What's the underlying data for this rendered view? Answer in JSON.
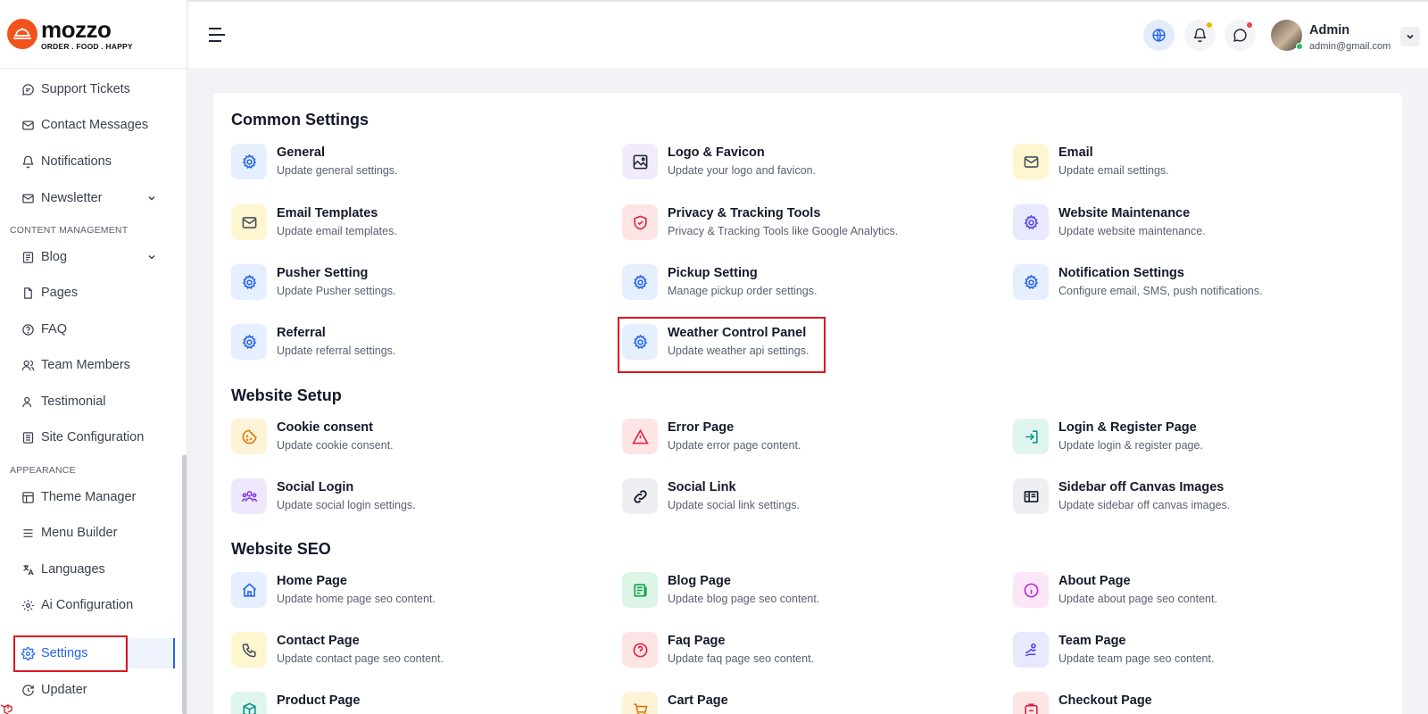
{
  "brand": {
    "name": "mozzo",
    "tagline": "ORDER . FOOD . HAPPY"
  },
  "sidebar": {
    "items": [
      {
        "label": "Support Tickets",
        "icon": "chat-icon"
      },
      {
        "label": "Contact Messages",
        "icon": "mail-icon"
      },
      {
        "label": "Notifications",
        "icon": "bell-icon"
      },
      {
        "label": "Newsletter",
        "icon": "newsletter-icon"
      },
      {
        "label": "Blog",
        "icon": "blog-icon"
      },
      {
        "label": "Pages",
        "icon": "page-icon"
      },
      {
        "label": "FAQ",
        "icon": "help-icon"
      },
      {
        "label": "Team Members",
        "icon": "users-icon"
      },
      {
        "label": "Testimonial",
        "icon": "user-icon"
      },
      {
        "label": "Site Configuration",
        "icon": "config-icon"
      },
      {
        "label": "Theme Manager",
        "icon": "theme-icon"
      },
      {
        "label": "Menu Builder",
        "icon": "menu-icon"
      },
      {
        "label": "Languages",
        "icon": "language-icon"
      },
      {
        "label": "Ai Configuration",
        "icon": "ai-icon"
      },
      {
        "label": "Settings",
        "icon": "gear-icon"
      },
      {
        "label": "Updater",
        "icon": "update-icon"
      }
    ],
    "sections": [
      "CONTENT MANAGEMENT",
      "APPEARANCE"
    ],
    "active": "Settings"
  },
  "header": {
    "user_name": "Admin",
    "user_email": "admin@gmail.com"
  },
  "sections": [
    {
      "title": "Common Settings",
      "items": [
        {
          "title": "General",
          "desc": "Update general settings.",
          "icon": "gear-icon"
        },
        {
          "title": "Logo & Favicon",
          "desc": "Update your logo and favicon.",
          "icon": "image-icon"
        },
        {
          "title": "Email",
          "desc": "Update email settings.",
          "icon": "mail-icon"
        },
        {
          "title": "Email Templates",
          "desc": "Update email templates.",
          "icon": "mail-icon"
        },
        {
          "title": "Privacy & Tracking Tools",
          "desc": "Privacy & Tracking Tools like Google Analytics.",
          "icon": "shield-icon"
        },
        {
          "title": "Website Maintenance",
          "desc": "Update website maintenance.",
          "icon": "gear-icon"
        },
        {
          "title": "Pusher Setting",
          "desc": "Update Pusher settings.",
          "icon": "gear-icon"
        },
        {
          "title": "Pickup Setting",
          "desc": "Manage pickup order settings.",
          "icon": "gear-icon"
        },
        {
          "title": "Notification Settings",
          "desc": "Configure email, SMS, push notifications.",
          "icon": "gear-icon"
        },
        {
          "title": "Referral",
          "desc": "Update referral settings.",
          "icon": "gear-icon"
        },
        {
          "title": "Weather Control Panel",
          "desc": "Update weather api settings.",
          "icon": "gear-icon"
        }
      ]
    },
    {
      "title": "Website Setup",
      "items": [
        {
          "title": "Cookie consent",
          "desc": "Update cookie consent.",
          "icon": "cookie-icon"
        },
        {
          "title": "Error Page",
          "desc": "Update error page content.",
          "icon": "warning-icon"
        },
        {
          "title": "Login & Register Page",
          "desc": "Update login & register page.",
          "icon": "login-icon"
        },
        {
          "title": "Social Login",
          "desc": "Update social login settings.",
          "icon": "users-icon"
        },
        {
          "title": "Social Link",
          "desc": "Update social link settings.",
          "icon": "link-icon"
        },
        {
          "title": "Sidebar off Canvas Images",
          "desc": "Update sidebar off canvas images.",
          "icon": "sidebar-icon"
        }
      ]
    },
    {
      "title": "Website SEO",
      "items": [
        {
          "title": "Home Page",
          "desc": "Update home page seo content.",
          "icon": "home-icon"
        },
        {
          "title": "Blog Page",
          "desc": "Update blog page seo content.",
          "icon": "news-icon"
        },
        {
          "title": "About Page",
          "desc": "Update about page seo content.",
          "icon": "info-icon"
        },
        {
          "title": "Contact Page",
          "desc": "Update contact page seo content.",
          "icon": "phone-icon"
        },
        {
          "title": "Faq Page",
          "desc": "Update faq page seo content.",
          "icon": "help-icon"
        },
        {
          "title": "Team Page",
          "desc": "Update team page seo content.",
          "icon": "team-icon"
        },
        {
          "title": "Product Page",
          "desc": "",
          "icon": "box-icon"
        },
        {
          "title": "Cart Page",
          "desc": "",
          "icon": "cart-icon"
        },
        {
          "title": "Checkout Page",
          "desc": "",
          "icon": "checkout-icon"
        }
      ]
    }
  ]
}
